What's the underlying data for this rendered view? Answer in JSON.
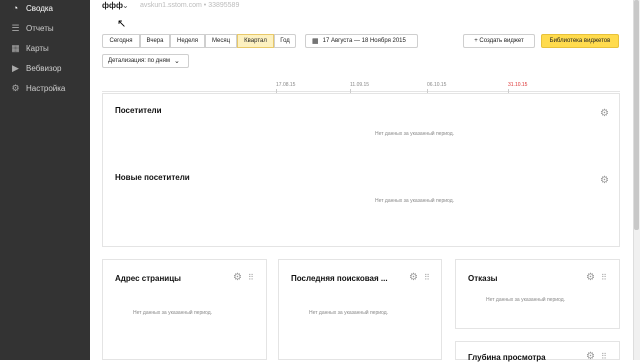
{
  "sidebar": {
    "items": [
      {
        "label": "Сводка",
        "icon": "dashboard-icon",
        "glyph": "◔"
      },
      {
        "label": "Отчеты",
        "icon": "reports-icon",
        "glyph": "☰"
      },
      {
        "label": "Карты",
        "icon": "maps-icon",
        "glyph": "▦"
      },
      {
        "label": "Вебвизор",
        "icon": "webvisor-play-icon",
        "glyph": "▶"
      },
      {
        "label": "Настройка",
        "icon": "settings-gear-icon",
        "glyph": "⚙"
      }
    ]
  },
  "header": {
    "counter_name": "ффф",
    "counter_url": "avskun1.sstom.com  •  33895589"
  },
  "periods": [
    "Сегодня",
    "Вчера",
    "Неделя",
    "Месяц",
    "Квартал",
    "Год"
  ],
  "active_period": "Квартал",
  "date_range": "17 Августа — 18 Ноября 2015",
  "detail_select": "Детализация: по дням",
  "create_widget": "+ Создать виджет",
  "widget_library": "Библиотека виджетов",
  "ruler_ticks": [
    "17.08.15",
    "11.09.15",
    "06.10.15",
    "31.10.15"
  ],
  "nodata": "Нет данных за указанный период.",
  "cards": {
    "visitors": "Посетители",
    "new_visitors": "Новые посетители",
    "page_address": "Адрес страницы",
    "last_search": "Последняя поисковая ...",
    "bounces": "Отказы",
    "depth": "Глубина просмотра"
  },
  "colors": {
    "sidebar_bg": "#333333",
    "accent_yellow": "#ffdb4d",
    "active_period_bg": "#fdf1c0",
    "tick_highlight": "#dd3333"
  }
}
